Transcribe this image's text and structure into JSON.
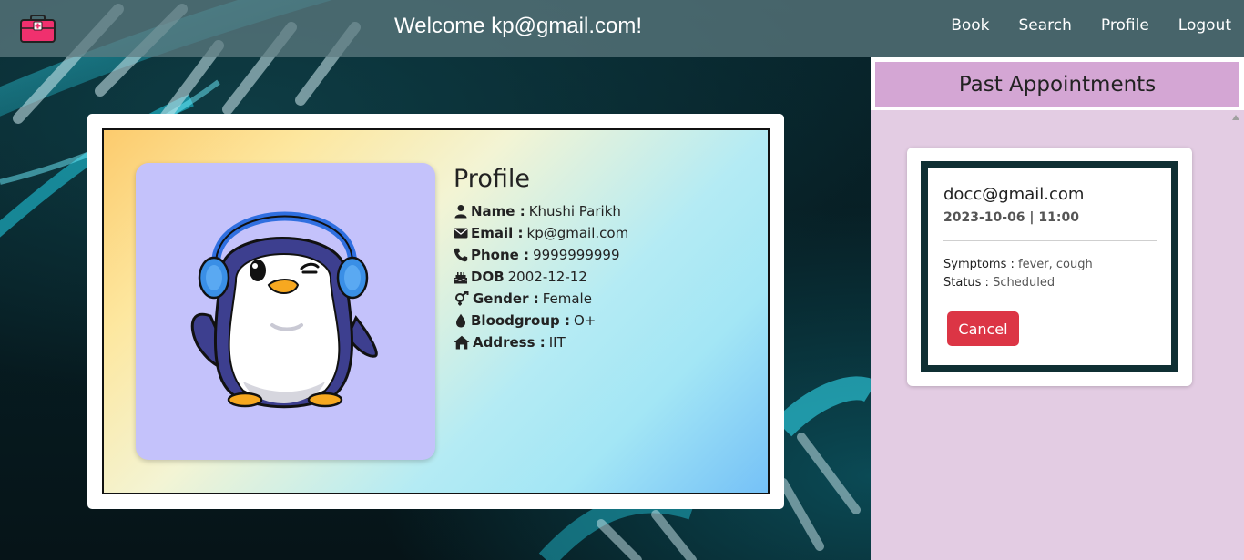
{
  "navbar": {
    "title": "Welcome kp@gmail.com!",
    "brand_icon": "first-aid-kit-icon",
    "links": [
      "Book",
      "Search",
      "Profile",
      "Logout"
    ]
  },
  "profile": {
    "title": "Profile",
    "avatar": "penguin-with-headphones",
    "fields": [
      {
        "icon": "user-icon",
        "label": "Name :",
        "value": "Khushi Parikh"
      },
      {
        "icon": "envelope-icon",
        "label": "Email :",
        "value": "kp@gmail.com"
      },
      {
        "icon": "phone-icon",
        "label": "Phone :",
        "value": "9999999999"
      },
      {
        "icon": "birthday-cake-icon",
        "label": "DOB",
        "value": "2002-12-12"
      },
      {
        "icon": "gender-icon",
        "label": "Gender :",
        "value": "Female"
      },
      {
        "icon": "droplet-icon",
        "label": "Bloodgroup :",
        "value": "O+"
      },
      {
        "icon": "home-icon",
        "label": "Address :",
        "value": "IIT"
      }
    ]
  },
  "past_appointments": {
    "header": "Past Appointments",
    "items": [
      {
        "doctor": "docc@gmail.com",
        "datetime": "2023-10-06 | 11:00",
        "symptoms_label": "Symptoms :",
        "symptoms": "fever, cough",
        "status_label": "Status :",
        "status": "Scheduled",
        "cancel_label": "Cancel"
      }
    ]
  },
  "colors": {
    "navbar": "#5f7d82",
    "past_header": "#d4a6d4",
    "list_bg": "#e3cce3",
    "cancel": "#dc3545",
    "avatar_bg": "#c4c2fb"
  }
}
